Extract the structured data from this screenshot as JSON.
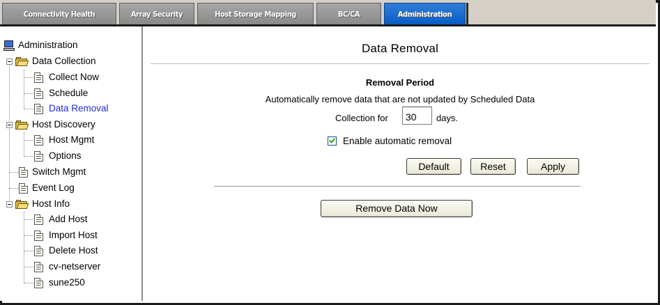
{
  "tabs": [
    {
      "label": "Connectivity Health",
      "active": false
    },
    {
      "label": "Array Security",
      "active": false
    },
    {
      "label": "Host Storage Mapping",
      "active": false
    },
    {
      "label": "BC/CA",
      "active": false
    },
    {
      "label": "Administration",
      "active": true
    }
  ],
  "sidebar": {
    "root": "Administration",
    "data_collection": {
      "label": "Data Collection",
      "items": [
        "Collect Now",
        "Schedule",
        "Data Removal"
      ]
    },
    "host_discovery": {
      "label": "Host Discovery",
      "items": [
        "Host Mgmt",
        "Options"
      ]
    },
    "switch_mgmt": "Switch Mgmt",
    "event_log": "Event Log",
    "host_info": {
      "label": "Host Info",
      "items": [
        "Add Host",
        "Import Host",
        "Delete Host",
        "cv-netserver",
        "sune250"
      ]
    },
    "selected": "Data Removal"
  },
  "main": {
    "title": "Data Removal",
    "section_title": "Removal Period",
    "description_line1": "Automatically remove data that are not updated by Scheduled Data",
    "description_line2": "Collection for",
    "days_value": "30",
    "days_unit": "days.",
    "auto_removal_label": "Enable automatic removal",
    "auto_removal_checked": true,
    "buttons": {
      "default": "Default",
      "reset": "Reset",
      "apply": "Apply",
      "remove_now": "Remove Data Now"
    }
  },
  "colors": {
    "active_tab": "#0a5cc6",
    "inactive_tab": "#8a8a8a",
    "selected_link": "#1d2fd6",
    "checkmark": "#21a121"
  }
}
